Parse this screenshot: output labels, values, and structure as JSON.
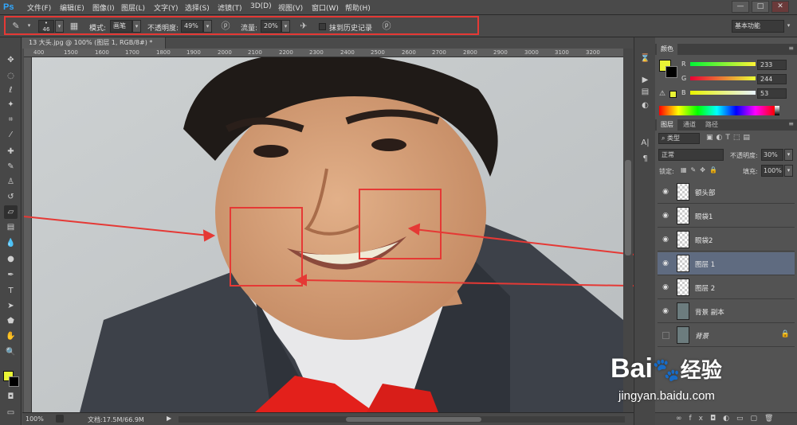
{
  "app": {
    "logo": "Ps"
  },
  "menubar": {
    "items": [
      "文件(F)",
      "编辑(E)",
      "图像(I)",
      "图层(L)",
      "文字(Y)",
      "选择(S)",
      "滤镜(T)",
      "3D(D)",
      "视图(V)",
      "窗口(W)",
      "帮助(H)"
    ],
    "window_buttons": [
      "—",
      "□",
      "✕"
    ]
  },
  "options": {
    "brush_size": "46",
    "mode_label": "模式:",
    "mode_value": "画笔",
    "opacity_label": "不透明度:",
    "opacity_value": "49%",
    "flow_label": "流量:",
    "flow_value": "20%",
    "history_label": "抹到历史记录",
    "workspace": "基本功能"
  },
  "document": {
    "tab_title": "13 大头.jpg @ 100% (图层 1, RGB/8#) *",
    "ruler_ticks": [
      "400",
      "1500",
      "1600",
      "1700",
      "1800",
      "1900",
      "2000",
      "2100",
      "2200",
      "2300",
      "2400",
      "2500",
      "2600",
      "2700",
      "2800",
      "2900",
      "3000",
      "3100",
      "3200"
    ],
    "zoom": "100%",
    "doc_info": "文档:17.5M/66.9M"
  },
  "color_panel": {
    "tabs": [
      "颜色"
    ],
    "r_label": "R",
    "g_label": "G",
    "b_label": "B",
    "r": "233",
    "g": "244",
    "b": "53",
    "foreground": "#e9f435",
    "background": "#000000"
  },
  "layers_panel": {
    "tabs": [
      "图层",
      "通道",
      "路径"
    ],
    "filter_label": "类型",
    "blend_mode": "正常",
    "opacity_label": "不透明度:",
    "opacity_value": "30%",
    "lock_label": "锁定:",
    "fill_label": "填充:",
    "fill_value": "100%",
    "layers": [
      {
        "name": "额头部",
        "selected": false,
        "visible": true
      },
      {
        "name": "眼袋1",
        "selected": false,
        "visible": true
      },
      {
        "name": "眼袋2",
        "selected": false,
        "visible": true
      },
      {
        "name": "图层 1",
        "selected": true,
        "visible": true
      },
      {
        "name": "图层 2",
        "selected": false,
        "visible": true
      },
      {
        "name": "背景 副本",
        "selected": false,
        "visible": true
      },
      {
        "name": "背景",
        "selected": false,
        "visible": false
      }
    ]
  },
  "watermark": {
    "brand": "Bai",
    "brand_cn": "经验",
    "url": "jingyan.baidu.com"
  },
  "colors": {
    "annotation": "#e53935",
    "selected_layer": "#5f6b80"
  }
}
